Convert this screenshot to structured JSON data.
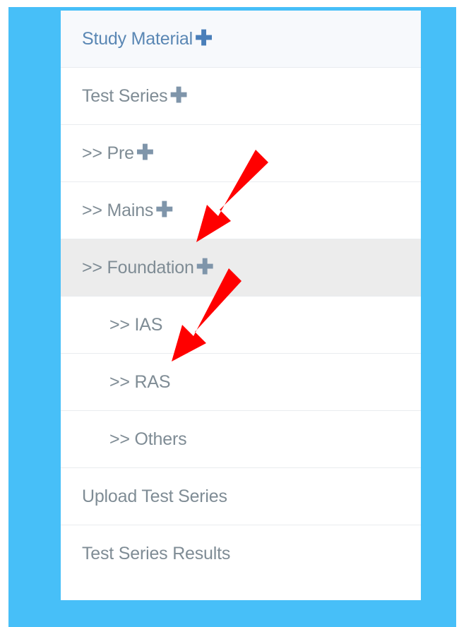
{
  "menu": {
    "items": [
      {
        "label": "Study Material",
        "icon": "plus-icon",
        "plus": "✚"
      },
      {
        "label": "Test Series",
        "icon": "plus-icon",
        "plus": "✚"
      },
      {
        "label": ">> Pre",
        "icon": "plus-icon",
        "plus": "✚"
      },
      {
        "label": ">> Mains",
        "icon": "plus-icon",
        "plus": "✚"
      },
      {
        "label": ">> Foundation",
        "icon": "plus-icon",
        "plus": "✚"
      },
      {
        "label": ">> IAS"
      },
      {
        "label": ">> RAS"
      },
      {
        "label": ">> Others"
      },
      {
        "label": "Upload Test Series"
      },
      {
        "label": "Test Series Results"
      }
    ]
  },
  "colors": {
    "frame": "#47bff8",
    "active_row": "#ececec",
    "arrow": "#ff0000"
  },
  "annotations": {
    "arrow_icon": "red-arrow-icon"
  }
}
